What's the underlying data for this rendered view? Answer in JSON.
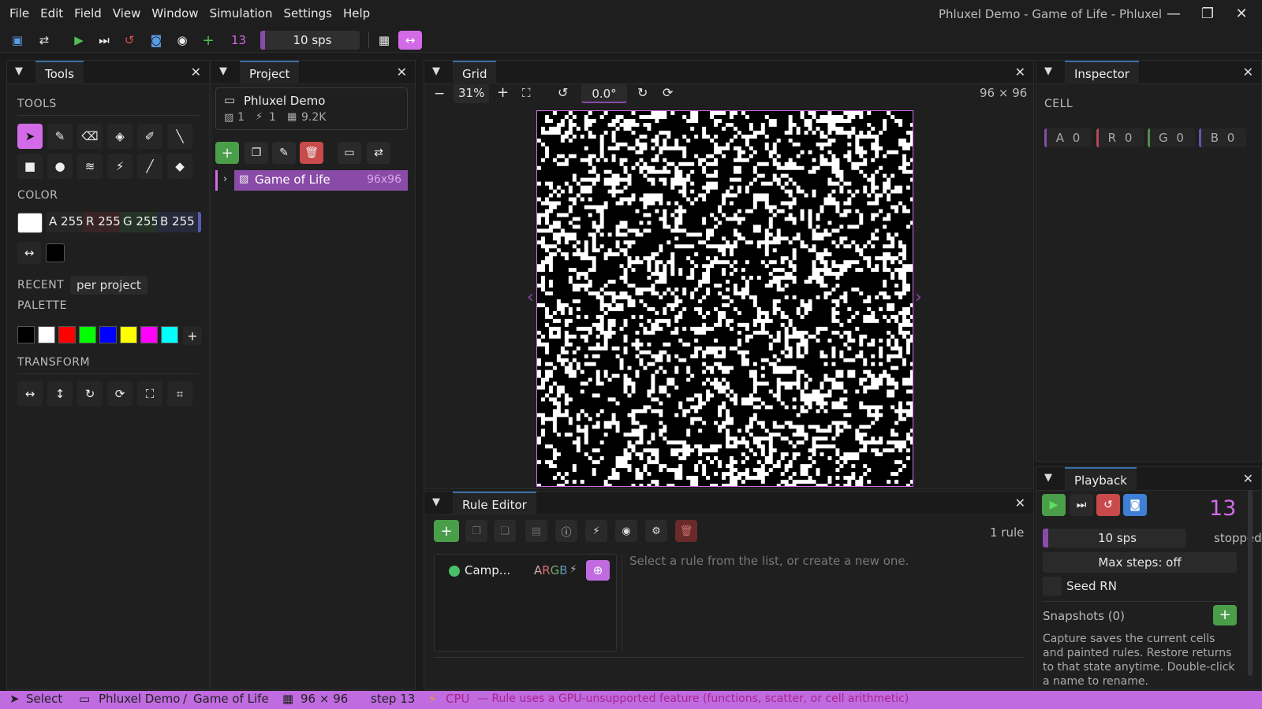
{
  "menu": [
    "File",
    "Edit",
    "Field",
    "View",
    "Window",
    "Simulation",
    "Settings",
    "Help"
  ],
  "window_title": "Phluxel Demo - Game of Life - Phluxel",
  "toolbar": {
    "step": "13",
    "sps": "10 sps"
  },
  "tools_panel": {
    "title": "Tools",
    "tools_label": "TOOLS",
    "color_label": "COLOR",
    "channels": {
      "a": "A 255",
      "r": "R 255",
      "g": "G 255",
      "b": "B 255"
    },
    "recent_label": "RECENT",
    "recent_mode": "per project",
    "palette_label": "PALETTE",
    "palette": [
      "#000000",
      "#ffffff",
      "#ff0000",
      "#00ff00",
      "#0000ff",
      "#ffff00",
      "#ff00ff",
      "#00ffff"
    ],
    "transform_label": "TRANSFORM"
  },
  "project_panel": {
    "title": "Project",
    "project_name": "Phluxel Demo",
    "count_images": "1",
    "count_rules": "1",
    "count_cells": "9.2K",
    "item_name": "Game of Life",
    "item_size": "96x96"
  },
  "grid_panel": {
    "title": "Grid",
    "zoom": "31%",
    "rotation": "0.0°",
    "dims": "96 × 96"
  },
  "inspector": {
    "title": "Inspector",
    "section": "CELL",
    "channels": {
      "a": "A 0",
      "r": "R 0",
      "g": "G 0",
      "b": "B 0"
    }
  },
  "rule_editor": {
    "title": "Rule Editor",
    "count": "1 rule",
    "rule_name": "Camp...",
    "channels": "ARGB",
    "placeholder": "Select a rule from the list, or create a new one."
  },
  "playback": {
    "title": "Playback",
    "step": "13",
    "sps": "10 sps",
    "state": "stopped",
    "max_steps": "Max steps: off",
    "seed_label": "Seed RN",
    "snapshots": "Snapshots (0)",
    "help": "Capture saves the current cells and painted rules. Restore returns to that state anytime. Double-click a name to rename."
  },
  "status": {
    "tool": "Select",
    "project": "Phluxel Demo",
    "separator": "/",
    "grid": "Game of Life",
    "dims": "96 × 96",
    "step": "step 13",
    "backend": "CPU",
    "message": "— Rule uses a GPU-unsupported feature (functions, scatter, or cell arithmetic)"
  },
  "colors": {
    "accent": "#d36be8",
    "status": "#c06be0",
    "green": "#4a9e4a",
    "red": "#c94a4a",
    "blue": "#3f7fd6"
  }
}
